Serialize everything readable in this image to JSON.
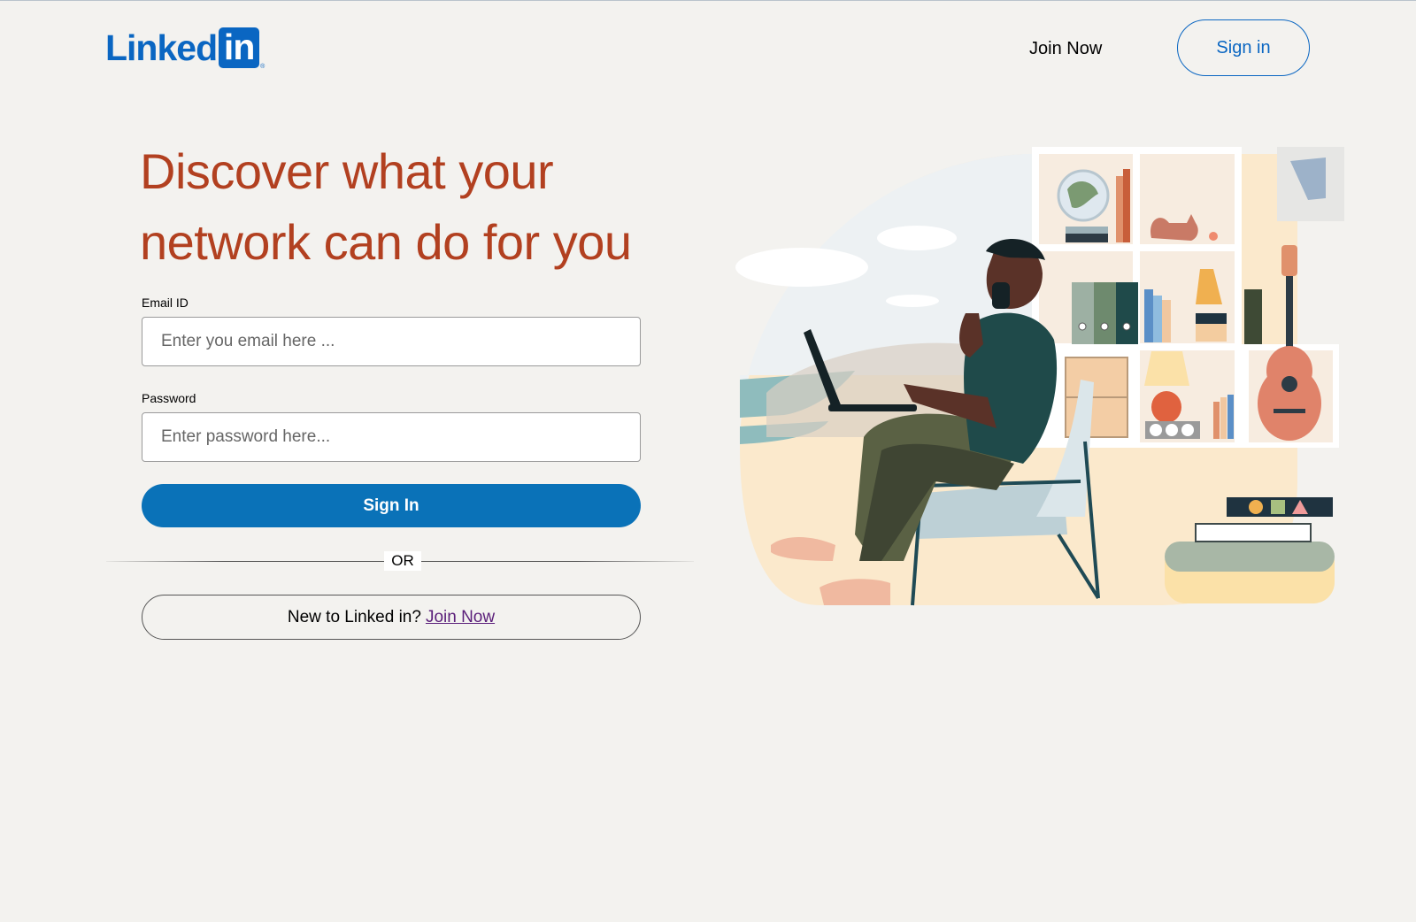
{
  "header": {
    "logo_text": "Linked",
    "logo_box_text": "in",
    "logo_reg": "®",
    "join_now": "Join Now",
    "sign_in": "Sign in"
  },
  "hero": {
    "headline": "Discover what your network can do for you"
  },
  "form": {
    "email_label": "Email ID",
    "email_placeholder": "Enter you email here ...",
    "email_value": "",
    "password_label": "Password",
    "password_placeholder": "Enter password here...",
    "password_value": "",
    "sign_in_button": "Sign In",
    "divider": "OR",
    "join_prompt": "New to Linked in?",
    "join_link": "Join Now"
  },
  "colors": {
    "brand_blue": "#0a66c2",
    "headline": "#b24020",
    "background": "#f3f2ef",
    "button": "#0a72b8"
  },
  "illustration": {
    "icon": "person-working-on-laptop-illustration"
  }
}
